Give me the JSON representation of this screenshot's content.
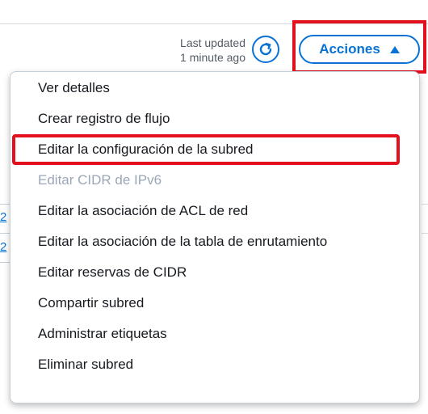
{
  "header": {
    "last_updated_line1": "Last updated",
    "last_updated_line2": "1 minute ago",
    "refresh_icon": "refresh-icon",
    "actions_label": "Acciones",
    "actions_icon": "caret-up-icon"
  },
  "background_rows": [
    {
      "link_text": "2"
    },
    {
      "link_text": "2"
    }
  ],
  "menu": {
    "items": [
      {
        "label": "Ver detalles",
        "disabled": false
      },
      {
        "label": "Crear registro de flujo",
        "disabled": false
      },
      {
        "label": "Editar la configuración de la subred",
        "disabled": false,
        "highlighted": true
      },
      {
        "label": "Editar CIDR de IPv6",
        "disabled": true
      },
      {
        "label": "Editar la asociación de ACL de red",
        "disabled": false
      },
      {
        "label": "Editar la asociación de la tabla de enrutamiento",
        "disabled": false
      },
      {
        "label": "Editar reservas de CIDR",
        "disabled": false
      },
      {
        "label": "Compartir subred",
        "disabled": false
      },
      {
        "label": "Administrar etiquetas",
        "disabled": false
      },
      {
        "label": "Eliminar subred",
        "disabled": false
      }
    ]
  },
  "colors": {
    "accent": "#0972d3",
    "highlight": "#e3101e",
    "disabled_text": "#9ba7b6"
  }
}
